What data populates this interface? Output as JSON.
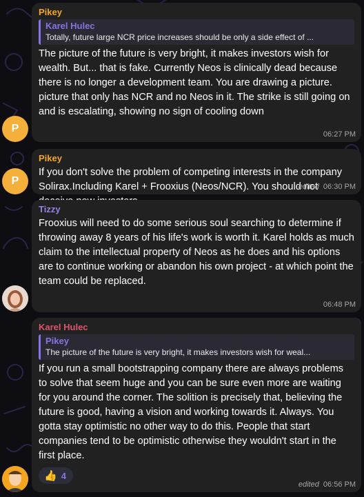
{
  "colors": {
    "sender_orange": "#f5a623",
    "sender_purple": "#9b7fe6",
    "sender_red": "#e0536b",
    "reply_accent": "#8774e1",
    "bubble": "#212121",
    "avatar_letter_bg": "#f4b03a"
  },
  "messages": [
    {
      "sender": "Pikey",
      "reply": {
        "name": "Karel Hulec",
        "text": "Totally, future large NCR price increases should be only a side effect of ..."
      },
      "text": "The picture of the future is very bright, it makes investors wish for wealth. But... that is fake. Currently Neos is clinically dead because there is no longer a development team. You are drawing a picture. picture that only has NCR and no Neos in it. The strike is still going on and is escalating, showing no sign of cooling down",
      "time": "06:27 PM",
      "avatar_letter": "P"
    },
    {
      "sender": "Pikey",
      "text": "If you don't solve the problem of competing interests in the company Solirax.Including Karel + Frooxius (Neos/NCR). You should not deceive new investors",
      "edited": "edited",
      "time": "06:30 PM",
      "avatar_letter": "P"
    },
    {
      "sender": "Tizzy",
      "text": "Frooxius will need to do some serious soul searching to determine if throwing away 8 years of his life's work is worth it. Karel holds as much claim to the intellectual property of Neos as he does and his options are to continue working or abandon his own project - at which point the team could be replaced.",
      "time": "06:48 PM"
    },
    {
      "sender": "Karel Hulec",
      "reply": {
        "name": "Pikey",
        "text": "The picture of the future is very bright, it makes investors wish for weal..."
      },
      "text": "If you run a small bootstrapping company there are always problems to solve that seem huge and you can be sure even more are waiting for you around the corner. The solition is precisely that, believing the future is good, having a vision and working towards it. Always. You gotta stay optimistic no other way to do this. People that start companies tend to be optimistic otherwise they wouldn't start in the first place.",
      "reaction": {
        "emoji": "👍",
        "count": "4"
      },
      "edited": "edited",
      "time": "06:56 PM"
    }
  ]
}
